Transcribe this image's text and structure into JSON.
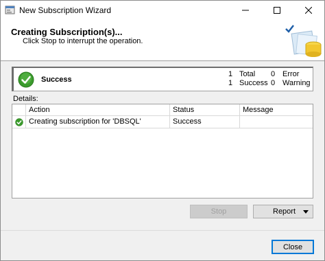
{
  "window": {
    "title": "New Subscription Wizard"
  },
  "header": {
    "title": "Creating Subscription(s)...",
    "subtitle": "Click Stop to interrupt the operation."
  },
  "status": {
    "label": "Success",
    "total_count": "1",
    "total_label": "Total",
    "success_count": "1",
    "success_label": "Success",
    "error_count": "0",
    "error_label": "Error",
    "warning_count": "0",
    "warning_label": "Warning"
  },
  "details": {
    "label": "Details:",
    "columns": [
      "Action",
      "Status",
      "Message"
    ],
    "rows": [
      {
        "icon": "success-check-icon",
        "action": "Creating subscription for 'DBSQL'",
        "status": "Success",
        "message": ""
      }
    ]
  },
  "buttons": {
    "stop": "Stop",
    "report": "Report",
    "close": "Close"
  },
  "colors": {
    "success_green": "#3a9a2c",
    "focus_blue": "#0078d7"
  }
}
